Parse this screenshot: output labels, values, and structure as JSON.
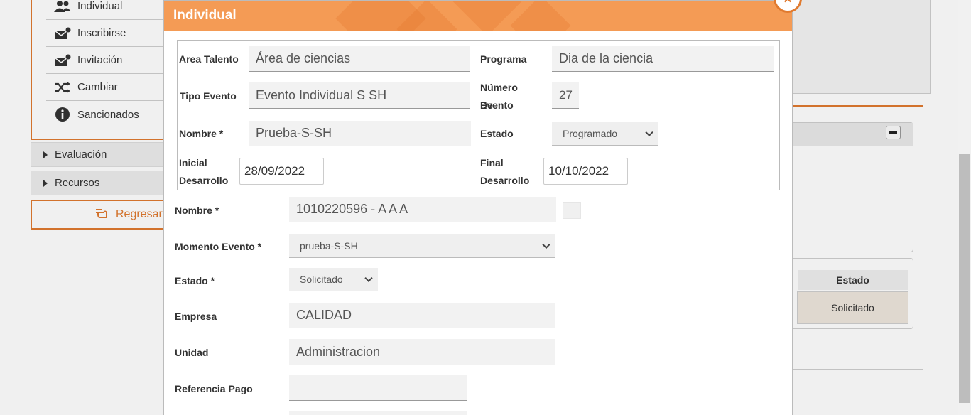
{
  "sidebar": {
    "items": [
      {
        "label": "Individual",
        "icon": "users-icon"
      },
      {
        "label": "Inscribirse",
        "icon": "mail-add-icon"
      },
      {
        "label": "Invitación",
        "icon": "mail-add-icon"
      },
      {
        "label": "Cambiar",
        "icon": "shuffle-icon"
      },
      {
        "label": "Sancionados",
        "icon": "info-icon"
      }
    ],
    "sections": [
      "Evaluación",
      "Recursos"
    ],
    "back_label": "Regresar"
  },
  "background_table": {
    "header": "Estado",
    "cell": "Solicitado"
  },
  "modal": {
    "title": "Individual",
    "close_glyph": "×",
    "info": {
      "area_talento_label": "Area Talento",
      "area_talento_value": "Área de ciencias",
      "programa_label": "Programa",
      "programa_value": "Dia de la ciencia",
      "tipo_evento_label": "Tipo Evento",
      "tipo_evento_value": "Evento Individual S SH",
      "numero_evento_label_1": "Número De",
      "numero_evento_label_2": "Evento",
      "numero_evento_value": "27",
      "nombre_label": "Nombre *",
      "nombre_value": "Prueba-S-SH",
      "estado_label": "Estado",
      "estado_value": "Programado",
      "inicial_label_1": "Inicial",
      "inicial_label_2": "Desarrollo",
      "inicial_value": "28/09/2022",
      "final_label_1": "Final",
      "final_label_2": "Desarrollo",
      "final_value": "10/10/2022"
    },
    "form": {
      "nombre_label": "Nombre *",
      "nombre_value": "1010220596 - A A A",
      "momento_label": "Momento Evento *",
      "momento_value": "prueba-S-SH",
      "estado_label": "Estado *",
      "estado_value": "Solicitado",
      "empresa_label": "Empresa",
      "empresa_value": "CALIDAD",
      "unidad_label": "Unidad",
      "unidad_value": "Administracion",
      "referencia_label": "Referencia Pago",
      "referencia_value": ""
    }
  },
  "colors": {
    "accent": "#e07a2f",
    "header": "#f49b55"
  }
}
